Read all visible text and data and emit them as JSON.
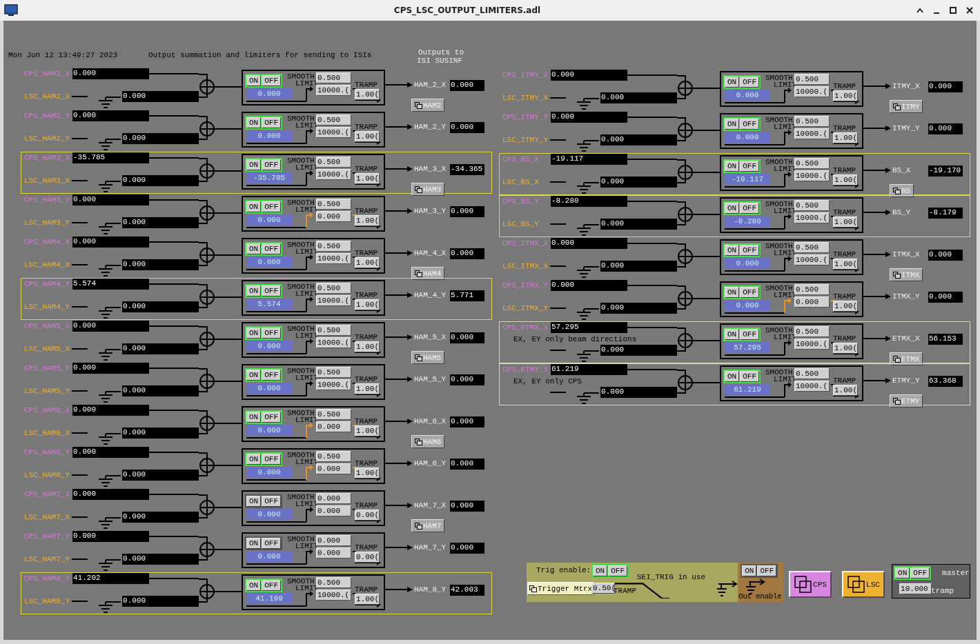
{
  "window": {
    "title": "CPS_LSC_OUTPUT_LIMITERS.adl"
  },
  "header": {
    "timestamp": "Mon Jun 12 13:49:27 2023",
    "description": "Output summation and limiters for sending to ISIs",
    "outputs_heading": [
      "Outputs to",
      "ISI SUSINF"
    ]
  },
  "columns": [
    {
      "channels": [
        {
          "cps_label": "CPS_HAM2_X",
          "cps_value": "0.000",
          "lsc_label": "LSC_HAM2_X",
          "lsc_value": "0.000",
          "switch": [
            "ON",
            "OFF"
          ],
          "enabled": true,
          "readback": "0.000",
          "captions": [
            "SMOOTH",
            "LIMIT",
            "TRAMP"
          ],
          "smooth": "0.500",
          "limit": "10000.(",
          "tramp": "1.00(",
          "limit_bypassed": false,
          "output_label": "HAM_2_X",
          "output_value": "0.000",
          "related_button": "HAM2"
        },
        {
          "cps_label": "CPS_HAM2_Y",
          "cps_value": "0.000",
          "lsc_label": "LSC_HAM2_Y",
          "lsc_value": "0.000",
          "switch": [
            "ON",
            "OFF"
          ],
          "enabled": true,
          "readback": "0.000",
          "captions": [
            "SMOOTH",
            "LIMIT",
            "TRAMP"
          ],
          "smooth": "0.500",
          "limit": "10000.(",
          "tramp": "1.00(",
          "limit_bypassed": false,
          "output_label": "HAM_2_Y",
          "output_value": "0.000"
        },
        {
          "cps_label": "CPS_HAM3_X",
          "cps_value": "-35.785",
          "lsc_label": "LSC_HAM3_X",
          "lsc_value": "0.000",
          "switch": [
            "ON",
            "OFF"
          ],
          "enabled": true,
          "readback": "-35.785",
          "captions": [
            "SMOOTH",
            "LIMIT",
            "TRAMP"
          ],
          "smooth": "0.500",
          "limit": "10000.(",
          "tramp": "1.00(",
          "limit_bypassed": false,
          "output_label": "HAM_3_X",
          "output_value": "-34.365",
          "color": "#e0d840",
          "related_button": "HAM3"
        },
        {
          "cps_label": "CPS_HAM3_Y",
          "cps_value": "0.000",
          "lsc_label": "LSC_HAM3_Y",
          "lsc_value": "0.000",
          "switch": [
            "ON",
            "OFF"
          ],
          "enabled": true,
          "readback": "0.000",
          "captions": [
            "SMOOTH",
            "LIMIT",
            "TRAMP"
          ],
          "smooth": "0.500",
          "limit": "0.000",
          "tramp": "1.00(",
          "limit_bypassed": true,
          "output_label": "HAM_3_Y",
          "output_value": "0.000"
        },
        {
          "cps_label": "CPS_HAM4_X",
          "cps_value": "0.000",
          "lsc_label": "LSC_HAM4_X",
          "lsc_value": "0.000",
          "switch": [
            "ON",
            "OFF"
          ],
          "enabled": true,
          "readback": "0.000",
          "captions": [
            "SMOOTH",
            "LIMIT",
            "TRAMP"
          ],
          "smooth": "0.500",
          "limit": "10000.(",
          "tramp": "1.00(",
          "limit_bypassed": false,
          "output_label": "HAM_4_X",
          "output_value": "0.000",
          "related_button": "HAM4"
        },
        {
          "cps_label": "CPS_HAM4_Y",
          "cps_value": "5.574",
          "lsc_label": "LSC_HAM4_Y",
          "lsc_value": "0.000",
          "switch": [
            "ON",
            "OFF"
          ],
          "enabled": true,
          "readback": "5.574",
          "captions": [
            "SMOOTH",
            "LIMIT",
            "TRAMP"
          ],
          "smooth": "0.500",
          "limit": "10000.(",
          "tramp": "1.00(",
          "limit_bypassed": false,
          "output_label": "HAM_4_Y",
          "output_value": "5.771",
          "color": "#e0d840"
        },
        {
          "cps_label": "CPS_HAM5_X",
          "cps_value": "0.000",
          "lsc_label": "LSC_HAM5_X",
          "lsc_value": "0.000",
          "switch": [
            "ON",
            "OFF"
          ],
          "enabled": true,
          "readback": "0.000",
          "captions": [
            "SMOOTH",
            "LIMIT",
            "TRAMP"
          ],
          "smooth": "0.500",
          "limit": "10000.(",
          "tramp": "1.00(",
          "limit_bypassed": false,
          "output_label": "HAM_5_X",
          "output_value": "0.000",
          "related_button": "HAM5"
        },
        {
          "cps_label": "CPS_HAM5_Y",
          "cps_value": "0.000",
          "lsc_label": "LSC_HAM5_Y",
          "lsc_value": "0.000",
          "switch": [
            "ON",
            "OFF"
          ],
          "enabled": true,
          "readback": "0.000",
          "captions": [
            "SMOOTH",
            "LIMIT",
            "TRAMP"
          ],
          "smooth": "0.500",
          "limit": "10000.(",
          "tramp": "1.00(",
          "limit_bypassed": false,
          "output_label": "HAM_5_Y",
          "output_value": "0.000"
        },
        {
          "cps_label": "CPS_HAM6_X",
          "cps_value": "0.000",
          "lsc_label": "LSC_HAM6_X",
          "lsc_value": "0.000",
          "switch": [
            "ON",
            "OFF"
          ],
          "enabled": true,
          "readback": "0.000",
          "captions": [
            "SMOOTH",
            "LIMIT",
            "TRAMP"
          ],
          "smooth": "0.500",
          "limit": "0.000",
          "tramp": "1.00(",
          "limit_bypassed": true,
          "output_label": "HAM_6_X",
          "output_value": "0.000",
          "related_button": "HAM6"
        },
        {
          "cps_label": "CPS_HAM6_Y",
          "cps_value": "0.000",
          "lsc_label": "LSC_HAM6_Y",
          "lsc_value": "0.000",
          "switch": [
            "ON",
            "OFF"
          ],
          "enabled": true,
          "readback": "0.000",
          "captions": [
            "SMOOTH",
            "LIMIT",
            "TRAMP"
          ],
          "smooth": "0.500",
          "limit": "0.000",
          "tramp": "1.00(",
          "limit_bypassed": true,
          "output_label": "HAM_6_Y",
          "output_value": "0.000"
        },
        {
          "cps_label": "CPS_HAM7_X",
          "cps_value": "0.000",
          "lsc_label": "LSC_HAM7_X",
          "lsc_value": "0.000",
          "switch": [
            "ON",
            "OFF"
          ],
          "enabled": false,
          "readback": "0.000",
          "captions": [
            "SMOOTH",
            "LIMIT",
            "TRAMP"
          ],
          "smooth": "0.000",
          "limit": "0.000",
          "tramp": "0.00(",
          "limit_bypassed": false,
          "output_label": "HAM_7_X",
          "output_value": "0.000",
          "related_button": "HAM7"
        },
        {
          "cps_label": "CPS_HAM7_Y",
          "cps_value": "0.000",
          "lsc_label": "LSC_HAM7_Y",
          "lsc_value": "0.000",
          "switch": [
            "ON",
            "OFF"
          ],
          "enabled": false,
          "readback": "0.000",
          "captions": [
            "SMOOTH",
            "LIMIT",
            "TRAMP"
          ],
          "smooth": "0.000",
          "limit": "0.000",
          "tramp": "0.00(",
          "limit_bypassed": false,
          "output_label": "HAM_7_Y",
          "output_value": "0.000"
        },
        {
          "cps_label": "CPS_HAM8_Y",
          "cps_value": "41.202",
          "lsc_label": "LSC_HAM8_Y",
          "lsc_value": "0.000",
          "switch": [
            "ON",
            "OFF"
          ],
          "enabled": true,
          "readback": "41.199",
          "captions": [
            "SMOOTH",
            "LIMIT",
            "TRAMP"
          ],
          "smooth": "0.500",
          "limit": "10000.(",
          "tramp": "1.00(",
          "limit_bypassed": false,
          "output_label": "HAM_8_Y",
          "output_value": "42.003",
          "color": "#e0d840"
        }
      ]
    },
    {
      "channels": [
        {
          "cps_label": "CPS_ITMY_X",
          "cps_value": "0.000",
          "lsc_label": "LSC_ITMY_X",
          "lsc_value": "0.000",
          "switch": [
            "ON",
            "OFF"
          ],
          "enabled": true,
          "readback": "0.000",
          "captions": [
            "SMOOTH",
            "LIMIT",
            "TRAMP"
          ],
          "smooth": "0.500",
          "limit": "10000.(",
          "tramp": "1.00(",
          "limit_bypassed": false,
          "output_label": "ITMY_X",
          "output_value": "0.000",
          "related_button": "ITMY"
        },
        {
          "cps_label": "CPS_ITMY_Y",
          "cps_value": "0.000",
          "lsc_label": "LSC_ITMY_Y",
          "lsc_value": "0.000",
          "switch": [
            "ON",
            "OFF"
          ],
          "enabled": true,
          "readback": "0.000",
          "captions": [
            "SMOOTH",
            "LIMIT",
            "TRAMP"
          ],
          "smooth": "0.500",
          "limit": "10000.(",
          "tramp": "1.00(",
          "limit_bypassed": false,
          "output_label": "ITMY_Y",
          "output_value": "0.000"
        },
        {
          "cps_label": "CPS_BS_X",
          "cps_value": "-19.117",
          "lsc_label": "LSC_BS_X",
          "lsc_value": "0.000",
          "switch": [
            "ON",
            "OFF"
          ],
          "enabled": true,
          "readback": "-19.117",
          "captions": [
            "SMOOTH",
            "LIMIT",
            "TRAMP"
          ],
          "smooth": "0.500",
          "limit": "10000.(",
          "tramp": "1.00(",
          "limit_bypassed": false,
          "output_label": "BS_X",
          "output_value": "-19.170",
          "color": "#e0d840",
          "related_button": "BS"
        },
        {
          "cps_label": "CPS_BS_Y",
          "cps_value": "-8.280",
          "lsc_label": "LSC_BS_Y",
          "lsc_value": "0.000",
          "switch": [
            "ON",
            "OFF"
          ],
          "enabled": true,
          "readback": "-8.280",
          "captions": [
            "SMOOTH",
            "LIMIT",
            "TRAMP"
          ],
          "smooth": "0.500",
          "limit": "10000.(",
          "tramp": "1.00(",
          "limit_bypassed": false,
          "output_label": "BS_Y",
          "output_value": "-8.179",
          "color": "#e0d840"
        },
        {
          "cps_label": "CPS_ITMX_X",
          "cps_value": "0.000",
          "lsc_label": "LSC_ITMX_X",
          "lsc_value": "0.000",
          "switch": [
            "ON",
            "OFF"
          ],
          "enabled": true,
          "readback": "0.000",
          "captions": [
            "SMOOTH",
            "LIMIT",
            "TRAMP"
          ],
          "smooth": "0.500",
          "limit": "10000.(",
          "tramp": "1.00(",
          "limit_bypassed": false,
          "output_label": "ITMX_X",
          "output_value": "0.000",
          "related_button": "ITMX"
        },
        {
          "cps_label": "CPS_ITMX_Y",
          "cps_value": "0.000",
          "lsc_label": "LSC_ITMX_Y",
          "lsc_value": "0.000",
          "switch": [
            "ON",
            "OFF"
          ],
          "enabled": true,
          "readback": "0.000",
          "captions": [
            "SMOOTH",
            "LIMIT",
            "TRAMP"
          ],
          "smooth": "0.500",
          "limit": "0.000",
          "tramp": "1.00(",
          "limit_bypassed": true,
          "output_label": "ITMX_Y",
          "output_value": "0.000"
        },
        {
          "cps_label": "CPS_ETMX_X",
          "cps_value": "57.295",
          "note": "EX, EY only beam directions",
          "lsc_value": "0.000",
          "switch": [
            "ON",
            "OFF"
          ],
          "enabled": true,
          "readback": "57.295",
          "captions": [
            "SMOOTH",
            "LIMIT",
            "TRAMP"
          ],
          "smooth": "0.500",
          "limit": "10000.(",
          "tramp": "1.00(",
          "limit_bypassed": false,
          "output_label": "ETMX_X",
          "output_value": "56.153",
          "color": "#d8d8b8",
          "related_button": "ETMX"
        },
        {
          "cps_label": "CPS_ETMY_Y",
          "cps_value": "61.219",
          "note": "EX, EY only CPS",
          "lsc_value": "0.000",
          "switch": [
            "ON",
            "OFF"
          ],
          "enabled": true,
          "readback": "61.219",
          "captions": [
            "SMOOTH",
            "LIMIT",
            "TRAMP"
          ],
          "smooth": "0.500",
          "limit": "10000.(",
          "tramp": "1.00(",
          "limit_bypassed": false,
          "output_label": "ETMY_Y",
          "output_value": "63.368",
          "color": "#d8d8b8",
          "related_button": "ETMY"
        }
      ]
    }
  ],
  "trigger_panel": {
    "label": "Trig enable:",
    "switch": [
      "ON",
      "OFF"
    ],
    "enabled": true,
    "matrix_button": "Trigger Mtrx",
    "tramp_value": "0.50(",
    "tramp_label": "TRAMP",
    "status": "SEI_TRIG in use"
  },
  "out_enable": {
    "switch": [
      "ON",
      "OFF"
    ],
    "enabled": false,
    "label": "Out enable"
  },
  "shortcuts": [
    {
      "label": "CPS",
      "color": "#d888e0"
    },
    {
      "label": "LSC",
      "color": "#f0b030"
    }
  ],
  "master": {
    "switch": [
      "ON",
      "OFF"
    ],
    "enabled": true,
    "label": "master",
    "tramp_value": "10.000",
    "tramp_label": "tramp"
  }
}
